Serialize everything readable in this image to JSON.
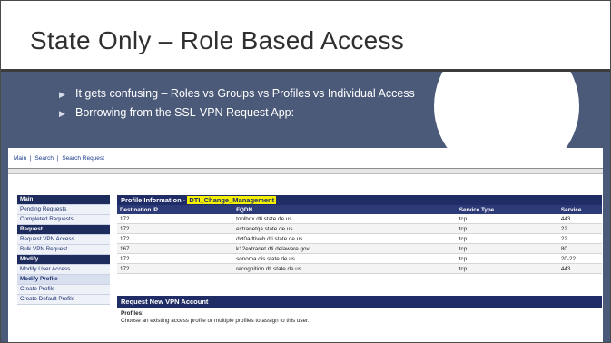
{
  "slide": {
    "title": "State Only – Role Based Access",
    "bullets": [
      "It gets confusing – Roles vs Groups vs Profiles vs Individual Access",
      "Borrowing from the SSL-VPN Request App:"
    ]
  },
  "screenshot": {
    "nav": [
      "Main",
      "|",
      "Search",
      "|",
      "Search Request"
    ],
    "sidebar": [
      {
        "label": "Main",
        "style": "hdr"
      },
      {
        "label": "Pending Requests",
        "style": "item"
      },
      {
        "label": "Completed Requests",
        "style": "item"
      },
      {
        "label": "Request",
        "style": "hdr"
      },
      {
        "label": "Request VPN Access",
        "style": "item"
      },
      {
        "label": "Bulk VPN Request",
        "style": "item"
      },
      {
        "label": "Modify",
        "style": "hdr"
      },
      {
        "label": "Modify User Access",
        "style": "item"
      },
      {
        "label": "Modify Profile",
        "style": "strong"
      },
      {
        "label": "Create Profile",
        "style": "item"
      },
      {
        "label": "Create Default Profile",
        "style": "item"
      }
    ],
    "profile_panel": {
      "title_prefix": "Profile Information - ",
      "title_highlight": "DTI_Change_Management",
      "columns": [
        "Destination IP",
        "FQDN",
        "Service Type",
        "Service"
      ],
      "rows": [
        [
          "172.",
          "toolbox.dti.state.de.us",
          "tcp",
          "443"
        ],
        [
          "172.",
          "extranetqa.state.de.us",
          "tcp",
          "22"
        ],
        [
          "172.",
          "dvt0adtiveb.dti.state.de.us",
          "tcp",
          "22"
        ],
        [
          "167.",
          "k12extranet.dti.delaware.gov",
          "tcp",
          "80"
        ],
        [
          "172.",
          "sonoma.ois.state.de.us",
          "tcp",
          "20-22"
        ],
        [
          "172.",
          "recognition.dti.state.de.us",
          "tcp",
          "443"
        ]
      ]
    },
    "request_panel": {
      "title": "Request New VPN Account",
      "label": "Profiles:",
      "text": "Choose an existing access profile or multiple profiles to assign to this user."
    }
  }
}
